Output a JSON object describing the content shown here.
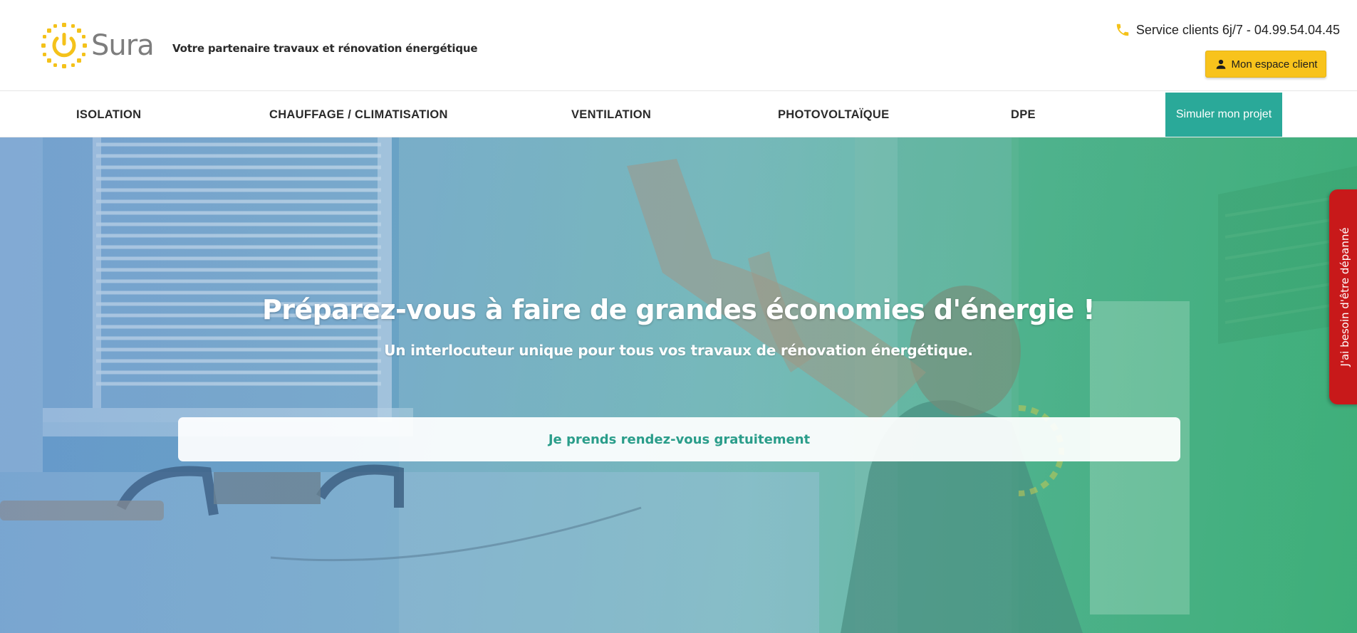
{
  "brand": {
    "name": "Sura",
    "tagline": "Votre partenaire travaux et rénovation énergétique",
    "logo_icon": "power-sun-icon",
    "accent_color": "#f4c21a",
    "wordmark_color": "#7d7d7d"
  },
  "header": {
    "service_text": "Service clients 6j/7 - 04.99.54.04.45",
    "phone_icon": "phone-icon",
    "client_button_label": "Mon espace client",
    "client_button_icon": "person-icon",
    "client_button_color": "#f8c31c"
  },
  "nav": {
    "items": [
      {
        "label": "ISOLATION"
      },
      {
        "label": "CHAUFFAGE / CLIMATISATION"
      },
      {
        "label": "VENTILATION"
      },
      {
        "label": "PHOTOVOLTAÏQUE"
      },
      {
        "label": "DPE"
      }
    ],
    "cta_label": "Simuler mon projet",
    "cta_color": "#2aa999"
  },
  "hero": {
    "title": "Préparez-vous à faire de grandes économies d'énergie !",
    "subtitle": "Un interlocuteur unique pour tous vos travaux de rénovation énergétique.",
    "cta_label": "Je prends rendez-vous gratuitement",
    "cta_text_color": "#2a9d8a"
  },
  "side_tab": {
    "label": "J'ai besoin d'être dépanné",
    "color": "#c8191a"
  }
}
